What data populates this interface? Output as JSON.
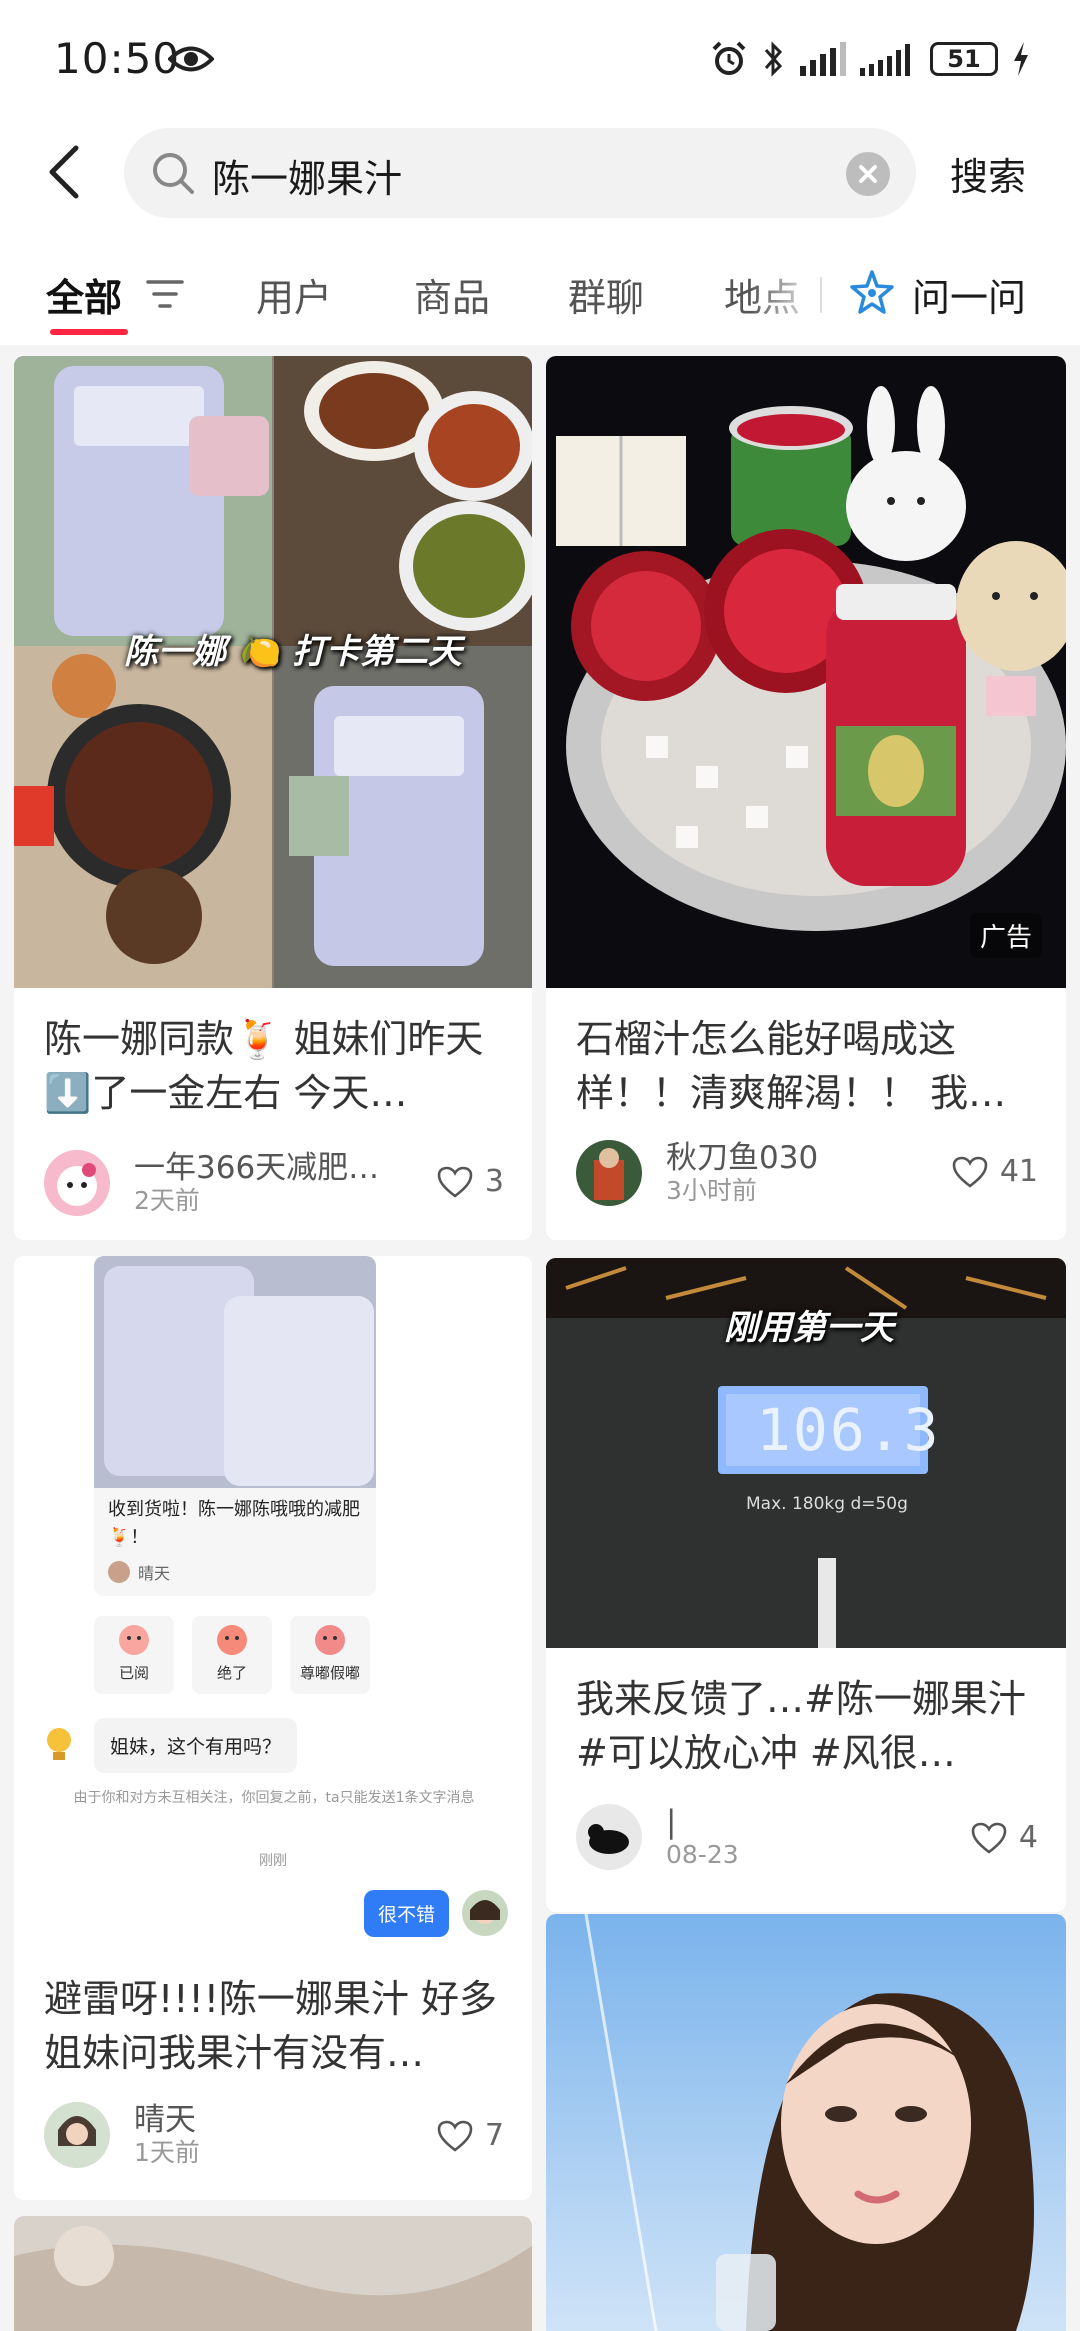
{
  "status_bar": {
    "time": "10:50",
    "battery": "51"
  },
  "search": {
    "query": "陈一娜果汁",
    "submit_label": "搜索"
  },
  "tabs": [
    {
      "label": "全部"
    },
    {
      "label": "用户"
    },
    {
      "label": "商品"
    },
    {
      "label": "群聊"
    },
    {
      "label": "地点"
    }
  ],
  "ask": {
    "label": "问一问"
  },
  "feed": {
    "left": [
      {
        "overlay": "陈一娜 🍋 打卡第二天",
        "title": "陈一娜同款🍹 姐妹们昨天⬇️了一金左右 今天…",
        "author": "一年366天减肥…",
        "time": "2天前",
        "likes": "3"
      },
      {
        "chat": {
          "product_caption": "收到货啦！陈一娜陈哦哦的减肥🍹！",
          "product_user": "晴天",
          "reactions": [
            "已阅",
            "绝了",
            "尊嘟假嘟"
          ],
          "question": "姐妹，这个有用吗？",
          "notice": "由于你和对方未互相关注，你回复之前，ta只能发送1条文字消息",
          "time": "刚刚",
          "reply": "很不错"
        },
        "title": "避雷呀!!!!陈一娜果汁 好多姐妹问我果汁有没有…",
        "author": "晴天",
        "time": "1天前",
        "likes": "7"
      }
    ],
    "right": [
      {
        "badge": "广告",
        "title": "石榴汁怎么能好喝成这样！！清爽解渴！！ 我…",
        "author": "秋刀鱼030",
        "time": "3小时前",
        "likes": "41"
      },
      {
        "overlay": "刚用第一天",
        "scale_reading": "106.3",
        "scale_spec": "Max. 180kg d=50g",
        "title": "我来反馈了…#陈一娜果汁 #可以放心冲 #风很…",
        "author": "|",
        "time": "08-23",
        "likes": "4"
      }
    ]
  },
  "colors": {
    "accent": "#ff2442",
    "background": "#f4f4f4",
    "chat_bubble": "#2f7cf6"
  }
}
